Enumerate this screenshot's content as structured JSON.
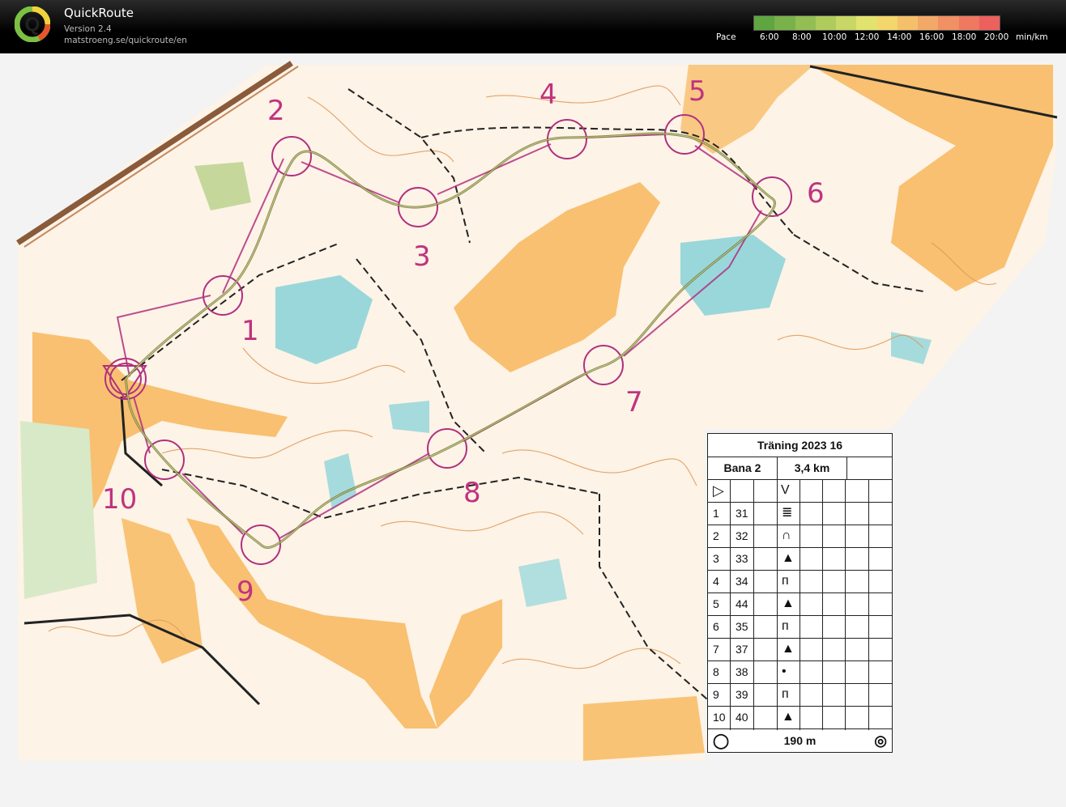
{
  "app": {
    "name": "QuickRoute",
    "version": "Version 2.4",
    "url": "matstroeng.se/quickroute/en"
  },
  "pace_scale": {
    "label": "Pace",
    "ticks": [
      "6:00",
      "8:00",
      "10:00",
      "12:00",
      "14:00",
      "16:00",
      "18:00",
      "20:00"
    ],
    "unit": "min/km",
    "colors": [
      "#5fa641",
      "#79b24a",
      "#93be53",
      "#aecb5c",
      "#c8d765",
      "#e2e36e",
      "#f3d66c",
      "#f4c069",
      "#f2a866",
      "#f09063",
      "#ee7860",
      "#ec605d"
    ]
  },
  "map": {
    "course_color": "#b03080",
    "route_color": "#6b6b2a",
    "controls": [
      {
        "label": "1"
      },
      {
        "label": "2"
      },
      {
        "label": "3"
      },
      {
        "label": "4"
      },
      {
        "label": "5"
      },
      {
        "label": "6"
      },
      {
        "label": "7"
      },
      {
        "label": "8"
      },
      {
        "label": "9"
      },
      {
        "label": "10"
      }
    ]
  },
  "legend": {
    "title": "Träning 2023   16",
    "course": "Bana 2",
    "length": "3,4 km",
    "rows": [
      {
        "num": "1",
        "code": "31",
        "symbol": "≣"
      },
      {
        "num": "2",
        "code": "32",
        "symbol": "∩"
      },
      {
        "num": "3",
        "code": "33",
        "symbol": "▲"
      },
      {
        "num": "4",
        "code": "34",
        "symbol": "ᴨ"
      },
      {
        "num": "5",
        "code": "44",
        "symbol": "▲"
      },
      {
        "num": "6",
        "code": "35",
        "symbol": "ᴨ"
      },
      {
        "num": "7",
        "code": "37",
        "symbol": "▲"
      },
      {
        "num": "8",
        "code": "38",
        "symbol": "•"
      },
      {
        "num": "9",
        "code": "39",
        "symbol": "ᴨ"
      },
      {
        "num": "10",
        "code": "40",
        "symbol": "▲"
      }
    ],
    "start_symbol": "▷",
    "start_desc": "V",
    "finish_distance": "190 m"
  }
}
